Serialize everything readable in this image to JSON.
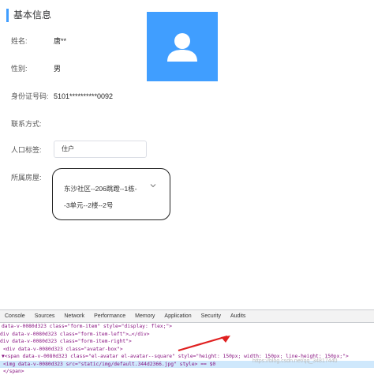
{
  "section": {
    "title": "基本信息"
  },
  "profile": {
    "name_label": "姓名:",
    "name_value": "唐**",
    "gender_label": "性别:",
    "gender_value": "男",
    "id_label": "身份证号码:",
    "id_value": "5101**********0092",
    "contact_label": "联系方式:",
    "contact_value": "",
    "tag_label": "人口标签:",
    "tag_value": "住户",
    "house_label": "所属房屋:",
    "house_line1": "东沙社区--206跳蹬--1栋-",
    "house_line2": "-3单元--2楼--2号"
  },
  "avatar": {
    "icon": "user-icon",
    "color": "#409eff"
  },
  "devtools": {
    "tabs": [
      "Console",
      "Sources",
      "Network",
      "Performance",
      "Memory",
      "Application",
      "Security",
      "Audits"
    ],
    "lines": [
      "data-v-0080d323 class=\"form-item\" style=\"display: flex;\">",
      "div data-v-0080d323 class=\"form-item-left\">…</div>",
      "div data-v-0080d323 class=\"form-item-right\">",
      "<div data-v-0080d323 class=\"avatar-box\">",
      "▼<span data-v-0080d323 class=\"el-avatar el-avatar--square\" style=\"height: 150px; width: 150px; line-height: 150px;\">",
      "<img data-v-0080d323 src=\"static/img/default.344d2366.jpg\" style> == $0",
      "</span>"
    ],
    "watermark": "https://blog.csdn.net/qq_34817440"
  }
}
